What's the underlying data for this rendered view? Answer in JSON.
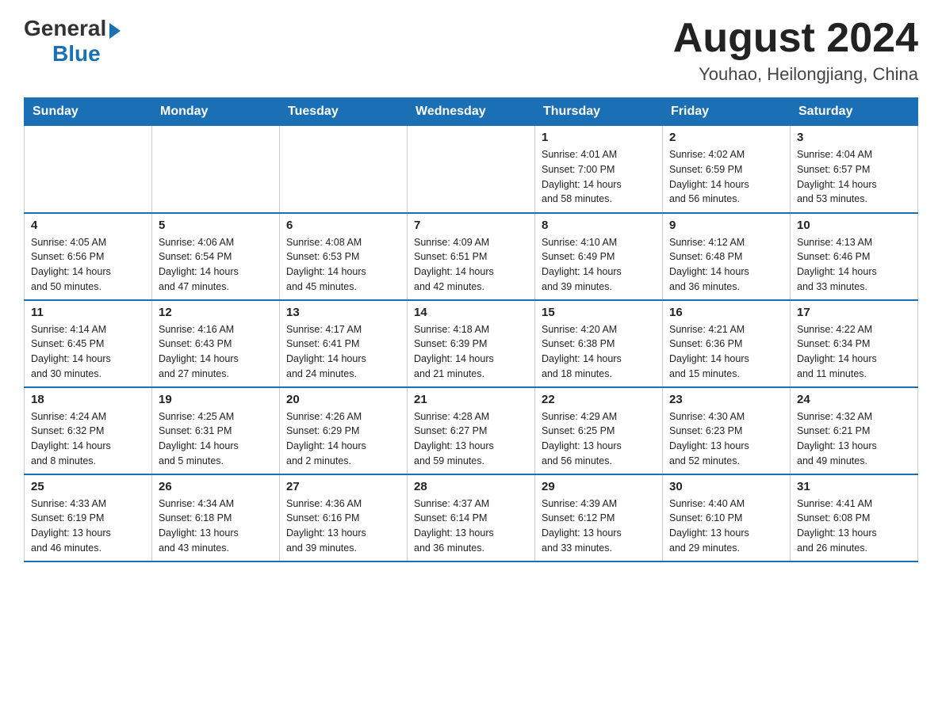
{
  "header": {
    "logo_general": "General",
    "logo_arrow": "▶",
    "logo_blue": "Blue",
    "title": "August 2024",
    "subtitle": "Youhao, Heilongjiang, China"
  },
  "days_of_week": [
    "Sunday",
    "Monday",
    "Tuesday",
    "Wednesday",
    "Thursday",
    "Friday",
    "Saturday"
  ],
  "weeks": [
    {
      "days": [
        {
          "number": "",
          "info": ""
        },
        {
          "number": "",
          "info": ""
        },
        {
          "number": "",
          "info": ""
        },
        {
          "number": "",
          "info": ""
        },
        {
          "number": "1",
          "info": "Sunrise: 4:01 AM\nSunset: 7:00 PM\nDaylight: 14 hours\nand 58 minutes."
        },
        {
          "number": "2",
          "info": "Sunrise: 4:02 AM\nSunset: 6:59 PM\nDaylight: 14 hours\nand 56 minutes."
        },
        {
          "number": "3",
          "info": "Sunrise: 4:04 AM\nSunset: 6:57 PM\nDaylight: 14 hours\nand 53 minutes."
        }
      ]
    },
    {
      "days": [
        {
          "number": "4",
          "info": "Sunrise: 4:05 AM\nSunset: 6:56 PM\nDaylight: 14 hours\nand 50 minutes."
        },
        {
          "number": "5",
          "info": "Sunrise: 4:06 AM\nSunset: 6:54 PM\nDaylight: 14 hours\nand 47 minutes."
        },
        {
          "number": "6",
          "info": "Sunrise: 4:08 AM\nSunset: 6:53 PM\nDaylight: 14 hours\nand 45 minutes."
        },
        {
          "number": "7",
          "info": "Sunrise: 4:09 AM\nSunset: 6:51 PM\nDaylight: 14 hours\nand 42 minutes."
        },
        {
          "number": "8",
          "info": "Sunrise: 4:10 AM\nSunset: 6:49 PM\nDaylight: 14 hours\nand 39 minutes."
        },
        {
          "number": "9",
          "info": "Sunrise: 4:12 AM\nSunset: 6:48 PM\nDaylight: 14 hours\nand 36 minutes."
        },
        {
          "number": "10",
          "info": "Sunrise: 4:13 AM\nSunset: 6:46 PM\nDaylight: 14 hours\nand 33 minutes."
        }
      ]
    },
    {
      "days": [
        {
          "number": "11",
          "info": "Sunrise: 4:14 AM\nSunset: 6:45 PM\nDaylight: 14 hours\nand 30 minutes."
        },
        {
          "number": "12",
          "info": "Sunrise: 4:16 AM\nSunset: 6:43 PM\nDaylight: 14 hours\nand 27 minutes."
        },
        {
          "number": "13",
          "info": "Sunrise: 4:17 AM\nSunset: 6:41 PM\nDaylight: 14 hours\nand 24 minutes."
        },
        {
          "number": "14",
          "info": "Sunrise: 4:18 AM\nSunset: 6:39 PM\nDaylight: 14 hours\nand 21 minutes."
        },
        {
          "number": "15",
          "info": "Sunrise: 4:20 AM\nSunset: 6:38 PM\nDaylight: 14 hours\nand 18 minutes."
        },
        {
          "number": "16",
          "info": "Sunrise: 4:21 AM\nSunset: 6:36 PM\nDaylight: 14 hours\nand 15 minutes."
        },
        {
          "number": "17",
          "info": "Sunrise: 4:22 AM\nSunset: 6:34 PM\nDaylight: 14 hours\nand 11 minutes."
        }
      ]
    },
    {
      "days": [
        {
          "number": "18",
          "info": "Sunrise: 4:24 AM\nSunset: 6:32 PM\nDaylight: 14 hours\nand 8 minutes."
        },
        {
          "number": "19",
          "info": "Sunrise: 4:25 AM\nSunset: 6:31 PM\nDaylight: 14 hours\nand 5 minutes."
        },
        {
          "number": "20",
          "info": "Sunrise: 4:26 AM\nSunset: 6:29 PM\nDaylight: 14 hours\nand 2 minutes."
        },
        {
          "number": "21",
          "info": "Sunrise: 4:28 AM\nSunset: 6:27 PM\nDaylight: 13 hours\nand 59 minutes."
        },
        {
          "number": "22",
          "info": "Sunrise: 4:29 AM\nSunset: 6:25 PM\nDaylight: 13 hours\nand 56 minutes."
        },
        {
          "number": "23",
          "info": "Sunrise: 4:30 AM\nSunset: 6:23 PM\nDaylight: 13 hours\nand 52 minutes."
        },
        {
          "number": "24",
          "info": "Sunrise: 4:32 AM\nSunset: 6:21 PM\nDaylight: 13 hours\nand 49 minutes."
        }
      ]
    },
    {
      "days": [
        {
          "number": "25",
          "info": "Sunrise: 4:33 AM\nSunset: 6:19 PM\nDaylight: 13 hours\nand 46 minutes."
        },
        {
          "number": "26",
          "info": "Sunrise: 4:34 AM\nSunset: 6:18 PM\nDaylight: 13 hours\nand 43 minutes."
        },
        {
          "number": "27",
          "info": "Sunrise: 4:36 AM\nSunset: 6:16 PM\nDaylight: 13 hours\nand 39 minutes."
        },
        {
          "number": "28",
          "info": "Sunrise: 4:37 AM\nSunset: 6:14 PM\nDaylight: 13 hours\nand 36 minutes."
        },
        {
          "number": "29",
          "info": "Sunrise: 4:39 AM\nSunset: 6:12 PM\nDaylight: 13 hours\nand 33 minutes."
        },
        {
          "number": "30",
          "info": "Sunrise: 4:40 AM\nSunset: 6:10 PM\nDaylight: 13 hours\nand 29 minutes."
        },
        {
          "number": "31",
          "info": "Sunrise: 4:41 AM\nSunset: 6:08 PM\nDaylight: 13 hours\nand 26 minutes."
        }
      ]
    }
  ]
}
